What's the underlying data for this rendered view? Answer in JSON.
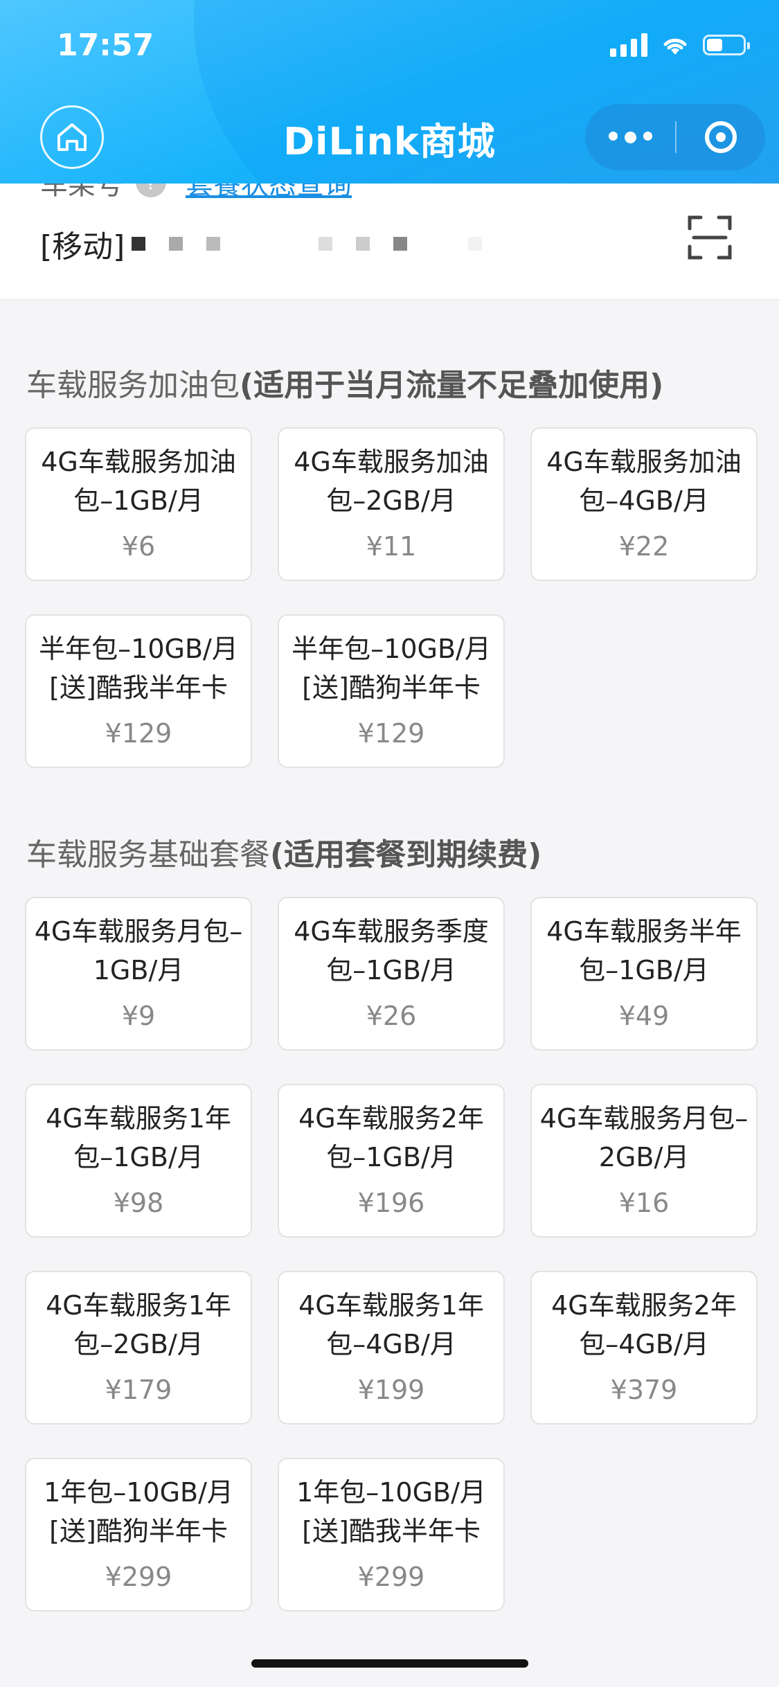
{
  "status_bar": {
    "time": "17:57"
  },
  "nav": {
    "title": "DiLink商城"
  },
  "info": {
    "label": "车架号",
    "link_text": "套餐状态查询",
    "carrier_prefix": "[移动]"
  },
  "sections": [
    {
      "title_light": "车载服务加油包",
      "title_bold": "(适用于当月流量不足叠加使用)",
      "items": [
        {
          "name": "4G车载服务加油包–1GB/月",
          "price": "¥6"
        },
        {
          "name": "4G车载服务加油包–2GB/月",
          "price": "¥11"
        },
        {
          "name": "4G车载服务加油包–4GB/月",
          "price": "¥22"
        },
        {
          "name": "半年包–10GB/月[送]酷我半年卡",
          "price": "¥129"
        },
        {
          "name": "半年包–10GB/月[送]酷狗半年卡",
          "price": "¥129"
        }
      ]
    },
    {
      "title_light": "车载服务基础套餐",
      "title_bold": "(适用套餐到期续费)",
      "items": [
        {
          "name": "4G车载服务月包–1GB/月",
          "price": "¥9"
        },
        {
          "name": "4G车载服务季度包–1GB/月",
          "price": "¥26"
        },
        {
          "name": "4G车载服务半年包–1GB/月",
          "price": "¥49"
        },
        {
          "name": "4G车载服务1年包–1GB/月",
          "price": "¥98"
        },
        {
          "name": "4G车载服务2年包–1GB/月",
          "price": "¥196"
        },
        {
          "name": "4G车载服务月包–2GB/月",
          "price": "¥16"
        },
        {
          "name": "4G车载服务1年包–2GB/月",
          "price": "¥179"
        },
        {
          "name": "4G车载服务1年包–4GB/月",
          "price": "¥199"
        },
        {
          "name": "4G车载服务2年包–4GB/月",
          "price": "¥379"
        },
        {
          "name": "1年包–10GB/月[送]酷狗半年卡",
          "price": "¥299"
        },
        {
          "name": "1年包–10GB/月[送]酷我半年卡",
          "price": "¥299"
        }
      ]
    }
  ]
}
